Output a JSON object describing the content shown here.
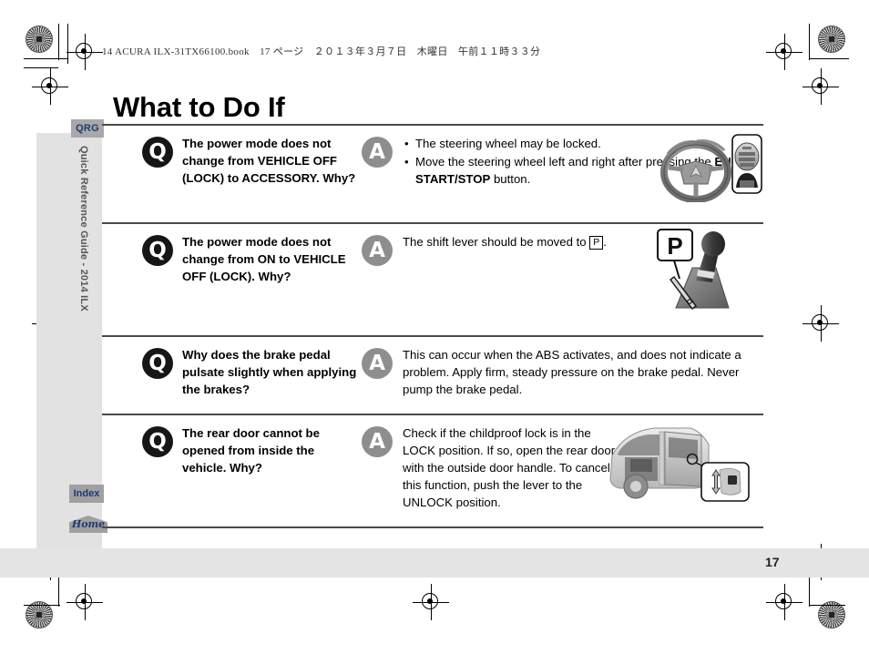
{
  "header": {
    "book_line": "14 ACURA ILX-31TX66100.book　17 ページ　２０１３年３月７日　木曜日　午前１１時３３分"
  },
  "page": {
    "title": "What to Do If",
    "number": "17"
  },
  "sidebar": {
    "tab_qrg": "QRG",
    "vertical_label": "Quick Reference Guide - 2014 ILX",
    "tab_index": "Index",
    "home_button": "Home"
  },
  "badges": {
    "question": "Q",
    "answer": "A"
  },
  "rows": [
    {
      "question": "The power mode does not change from VEHICLE OFF (LOCK) to ACCESSORY. Why?",
      "answer_bullets": [
        "The steering wheel may be locked.",
        "Move the steering wheel left and right after pressing the ENGINE START/STOP button."
      ],
      "answer_bold_term": "ENGINE START/STOP",
      "figure": "steering-wheel-and-engine-start-stop-button",
      "figure_label": "ENGINE START/STOP"
    },
    {
      "question": "The power mode does not change from ON to VEHICLE OFF (LOCK). Why?",
      "answer_prefix": "The shift lever should be moved to",
      "answer_boxed": "P",
      "answer_suffix": ".",
      "figure": "shift-lever-park-position",
      "figure_callout": "P"
    },
    {
      "question": "Why does the brake pedal pulsate slightly when applying the brakes?",
      "answer": "This can occur when the ABS activates, and does not indicate a problem. Apply firm, steady pressure on the brake pedal. Never pump the brake pedal.",
      "figure": null
    },
    {
      "question": "The rear door cannot be opened from inside the vehicle. Why?",
      "answer": "Check if the childproof lock is in the LOCK position. If so, open the rear door with the outside door handle. To cancel this function, push the lever to the UNLOCK position.",
      "figure": "rear-door-childproof-lock"
    }
  ],
  "colors": {
    "question_badge": "#161616",
    "answer_badge": "#8e8e8e",
    "tab_text": "#1c3b72",
    "sidebar_bg": "#e2e2e2",
    "rule": "#4a4a4a"
  }
}
